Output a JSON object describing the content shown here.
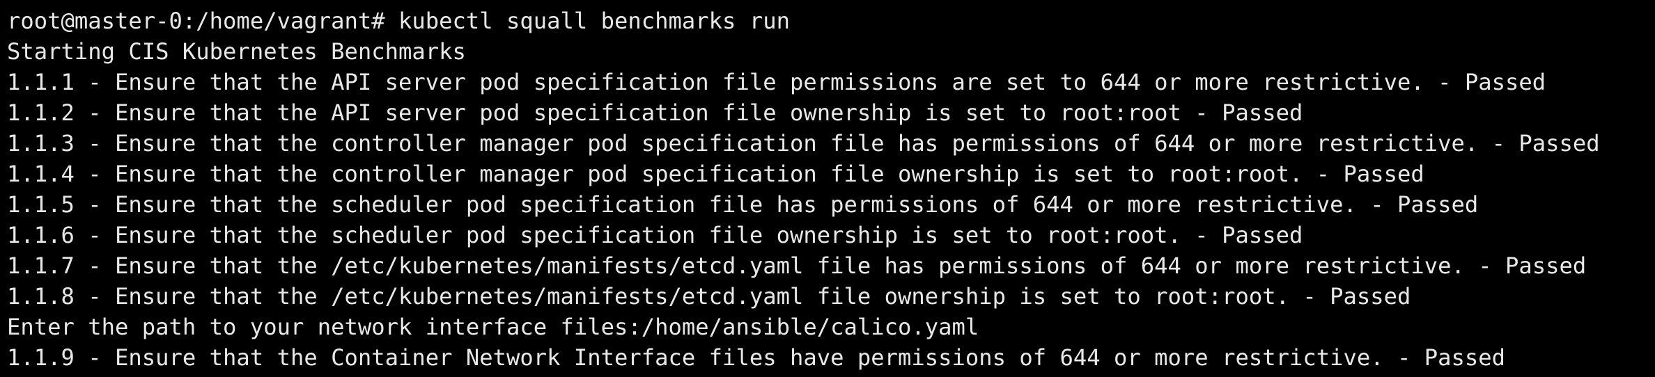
{
  "terminal": {
    "colors": {
      "background": "#000000",
      "foreground": "#e8e8e8"
    },
    "lines": [
      "root@master-0:/home/vagrant# kubectl squall benchmarks run",
      "Starting CIS Kubernetes Benchmarks",
      "1.1.1 - Ensure that the API server pod specification file permissions are set to 644 or more restrictive. - Passed",
      "1.1.2 - Ensure that the API server pod specification file ownership is set to root:root - Passed",
      "1.1.3 - Ensure that the controller manager pod specification file has permissions of 644 or more restrictive. - Passed",
      "1.1.4 - Ensure that the controller manager pod specification file ownership is set to root:root. - Passed",
      "1.1.5 - Ensure that the scheduler pod specification file has permissions of 644 or more restrictive. - Passed",
      "1.1.6 - Ensure that the scheduler pod specification file ownership is set to root:root. - Passed",
      "1.1.7 - Ensure that the /etc/kubernetes/manifests/etcd.yaml file has permissions of 644 or more restrictive. - Passed",
      "1.1.8 - Ensure that the /etc/kubernetes/manifests/etcd.yaml file ownership is set to root:root. - Passed",
      "Enter the path to your network interface files:/home/ansible/calico.yaml",
      "1.1.9 - Ensure that the Container Network Interface files have permissions of 644 or more restrictive. - Passed"
    ]
  }
}
